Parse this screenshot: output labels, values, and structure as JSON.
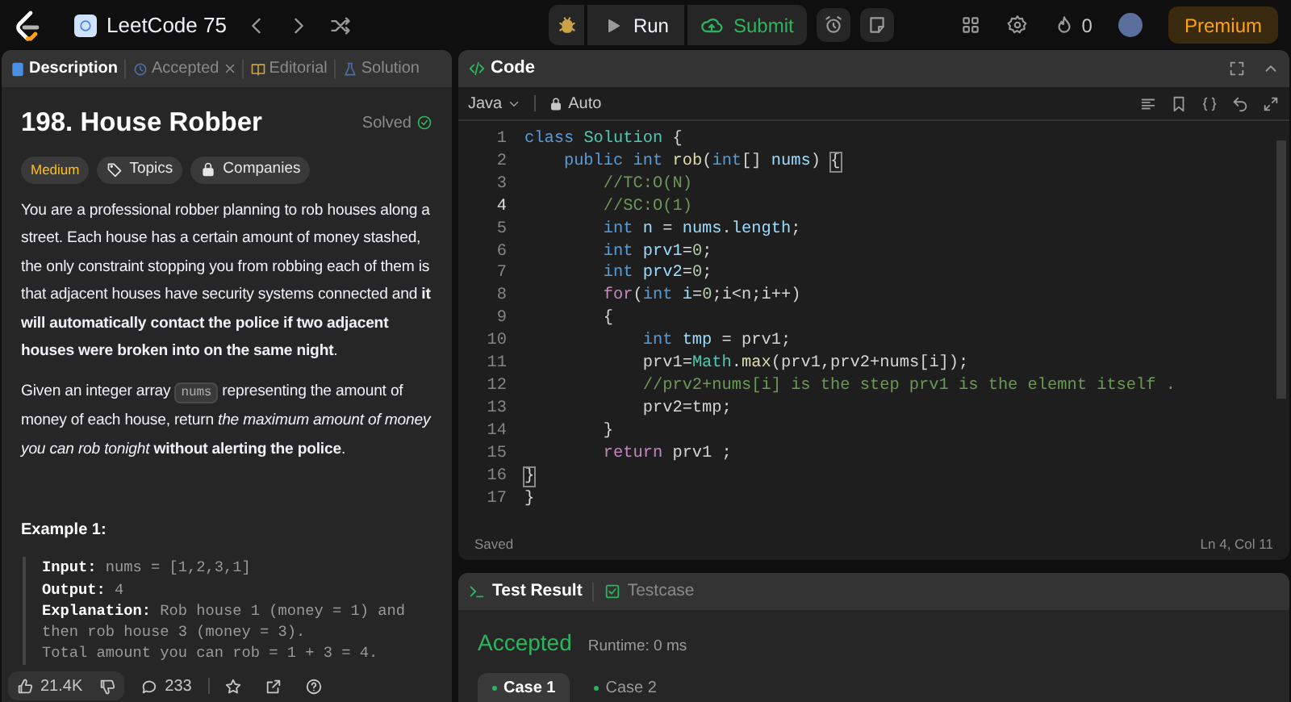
{
  "top_bar": {
    "list_title": "LeetCode 75",
    "run": "Run",
    "submit": "Submit",
    "streak": "0",
    "premium": "Premium"
  },
  "left_tabs": [
    {
      "label": "Description",
      "selected": true,
      "kind": "description"
    },
    {
      "label": "Accepted",
      "selected": false,
      "kind": "accepted"
    },
    {
      "label": "Editorial",
      "selected": false,
      "kind": "editorial"
    },
    {
      "label": "Solution",
      "selected": false,
      "kind": "solution"
    }
  ],
  "problem": {
    "title": "198. House Robber",
    "status": "Solved",
    "difficulty": "Medium",
    "tags": [
      {
        "label": "Topics",
        "kind": "topics"
      },
      {
        "label": "Companies",
        "kind": "companies"
      }
    ],
    "paragraphs": [
      [
        {
          "kind": "text",
          "text": "You are a professional robber planning to rob houses along a street. Each house has a certain amount of money stashed, the only constraint stopping you from robbing each of them is that adjacent houses have security systems connected and **it will automatically contact the police if two adjacent houses were broken into on the same night**."
        }
      ],
      [
        {
          "kind": "text",
          "text": "Given an integer array "
        },
        {
          "kind": "code",
          "text": "nums"
        },
        {
          "kind": "text",
          "text": " representing the amount of money of each house, return *the maximum amount of money you can rob tonight* **without alerting the police**."
        }
      ]
    ],
    "example": {
      "title": "Example 1:",
      "lines": [
        {
          "label": "Input:",
          "text": "nums = [1,2,3,1]"
        },
        {
          "label": "Output:",
          "text": "4"
        },
        {
          "label": "Explanation:",
          "text": "Rob house 1 (money = 1) and"
        },
        {
          "text": "then rob house 3 (money = 3)."
        },
        {
          "text": "Total amount you can rob = 1 + 3 = 4."
        }
      ]
    }
  },
  "left_footer": {
    "likes": "21.4K",
    "comments": "233"
  },
  "code_panel": {
    "title": "Code",
    "language": "Java",
    "mode": "Auto",
    "status": "Saved",
    "cursor": "Ln 4, Col 11",
    "lines": [
      {
        "number": "1",
        "current": false,
        "tokens": [
          {
            "kind": "keyword",
            "text": "class"
          },
          {
            "kind": "type",
            "text": " Solution"
          },
          {
            "kind": "plain",
            "text": " {"
          }
        ]
      },
      {
        "number": "2",
        "current": false,
        "tokens": [
          {
            "kind": "keyword",
            "text": "    public"
          },
          {
            "kind": "keyword",
            "text": " int"
          },
          {
            "kind": "function",
            "text": " rob"
          },
          {
            "kind": "plain",
            "text": "("
          },
          {
            "kind": "keyword",
            "text": "int"
          },
          {
            "kind": "plain",
            "text": "[]"
          },
          {
            "kind": "variable",
            "text": " nums"
          },
          {
            "kind": "plain",
            "text": ") "
          },
          {
            "kind": "match",
            "text": "{"
          }
        ]
      },
      {
        "number": "3",
        "current": false,
        "tokens": [
          {
            "kind": "comment",
            "text": "        //TC:O(N)"
          }
        ]
      },
      {
        "number": "4",
        "current": true,
        "tokens": [
          {
            "kind": "comment",
            "text": "        //SC:O(1)"
          }
        ]
      },
      {
        "number": "5",
        "current": false,
        "tokens": [
          {
            "kind": "keyword",
            "text": "        int"
          },
          {
            "kind": "variable",
            "text": " n"
          },
          {
            "kind": "plain",
            "text": " = "
          },
          {
            "kind": "variable",
            "text": "nums"
          },
          {
            "kind": "plain",
            "text": "."
          },
          {
            "kind": "variable",
            "text": "length"
          },
          {
            "kind": "plain",
            "text": ";"
          }
        ]
      },
      {
        "number": "6",
        "current": false,
        "tokens": [
          {
            "kind": "keyword",
            "text": "        int"
          },
          {
            "kind": "variable",
            "text": " prv1"
          },
          {
            "kind": "plain",
            "text": "="
          },
          {
            "kind": "number",
            "text": "0"
          },
          {
            "kind": "plain",
            "text": ";"
          }
        ]
      },
      {
        "number": "7",
        "current": false,
        "tokens": [
          {
            "kind": "keyword",
            "text": "        int"
          },
          {
            "kind": "variable",
            "text": " prv2"
          },
          {
            "kind": "plain",
            "text": "="
          },
          {
            "kind": "number",
            "text": "0"
          },
          {
            "kind": "plain",
            "text": ";"
          }
        ]
      },
      {
        "number": "8",
        "current": false,
        "tokens": [
          {
            "kind": "control",
            "text": "        for"
          },
          {
            "kind": "plain",
            "text": "("
          },
          {
            "kind": "keyword",
            "text": "int"
          },
          {
            "kind": "variable",
            "text": " i"
          },
          {
            "kind": "plain",
            "text": "="
          },
          {
            "kind": "number",
            "text": "0"
          },
          {
            "kind": "plain",
            "text": ";i<n;i++)"
          }
        ]
      },
      {
        "number": "9",
        "current": false,
        "tokens": [
          {
            "kind": "plain",
            "text": "        {"
          }
        ]
      },
      {
        "number": "10",
        "current": false,
        "tokens": [
          {
            "kind": "keyword",
            "text": "            int"
          },
          {
            "kind": "variable",
            "text": " tmp"
          },
          {
            "kind": "plain",
            "text": " = prv1;"
          }
        ]
      },
      {
        "number": "11",
        "current": false,
        "tokens": [
          {
            "kind": "plain",
            "text": "            prv1="
          },
          {
            "kind": "type",
            "text": "Math"
          },
          {
            "kind": "plain",
            "text": "."
          },
          {
            "kind": "function",
            "text": "max"
          },
          {
            "kind": "plain",
            "text": "(prv1,prv2+nums[i]);"
          }
        ]
      },
      {
        "number": "12",
        "current": false,
        "tokens": [
          {
            "kind": "comment",
            "text": "            //prv2+nums[i] is the step prv1 is the elemnt itself ."
          }
        ]
      },
      {
        "number": "13",
        "current": false,
        "tokens": [
          {
            "kind": "plain",
            "text": "            prv2=tmp;"
          }
        ]
      },
      {
        "number": "14",
        "current": false,
        "tokens": [
          {
            "kind": "plain",
            "text": "        }"
          }
        ]
      },
      {
        "number": "15",
        "current": false,
        "tokens": [
          {
            "kind": "control",
            "text": "        return"
          },
          {
            "kind": "plain",
            "text": " prv1 ;"
          }
        ]
      },
      {
        "number": "16",
        "current": false,
        "tokens": [
          {
            "kind": "match",
            "text": "}"
          }
        ]
      },
      {
        "number": "17",
        "current": false,
        "tokens": [
          {
            "kind": "plain",
            "text": "}"
          }
        ]
      }
    ]
  },
  "result_panel": {
    "tabs": [
      {
        "label": "Test Result",
        "selected": true,
        "kind": "result"
      },
      {
        "label": "Testcase",
        "selected": false,
        "kind": "testcase"
      }
    ],
    "verdict": "Accepted",
    "runtime": "Runtime: 0 ms",
    "cases": [
      {
        "label": "Case 1",
        "selected": true
      },
      {
        "label": "Case 2",
        "selected": false
      }
    ]
  }
}
